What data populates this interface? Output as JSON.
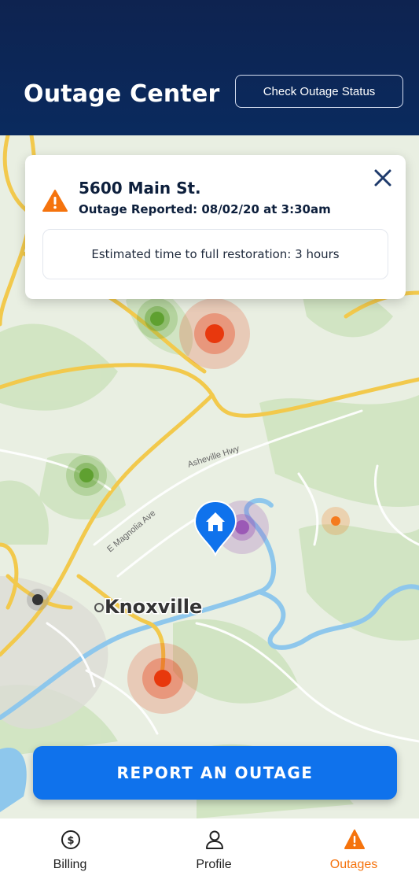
{
  "header": {
    "title": "Outage Center",
    "check_status_label": "Check Outage Status"
  },
  "map": {
    "city_label": "Knoxville",
    "road_labels": [
      "Asheville Hwy",
      "E Magnolia Ave"
    ],
    "markers": [
      {
        "color": "green",
        "size": "small"
      },
      {
        "color": "red",
        "size": "large"
      },
      {
        "color": "green",
        "size": "small"
      },
      {
        "color": "purple",
        "size": "medium"
      },
      {
        "color": "orange",
        "size": "small"
      },
      {
        "color": "gray",
        "size": "small"
      },
      {
        "color": "red",
        "size": "large"
      }
    ],
    "home_pin_icon": "home-icon"
  },
  "outage_card": {
    "address": "5600 Main St.",
    "reported": "Outage Reported: 08/02/20 at 3:30am",
    "restoration": "Estimated time to full restoration: 3 hours",
    "warning_icon": "warning-icon",
    "close_icon": "close-icon"
  },
  "report_button": {
    "label": "REPORT AN OUTAGE"
  },
  "tabbar": {
    "tabs": [
      {
        "label": "Billing",
        "icon": "dollar-icon"
      },
      {
        "label": "Profile",
        "icon": "person-icon"
      },
      {
        "label": "Outages",
        "icon": "warning-icon",
        "active": true
      }
    ]
  },
  "colors": {
    "header_bg": "#0a2a5e",
    "primary_blue": "#0f72ec",
    "active_orange": "#f5730d",
    "marker_red": "#e8380d",
    "marker_green": "#5fa030",
    "marker_purple": "#9b59b6",
    "marker_orange": "#f57a1d"
  }
}
